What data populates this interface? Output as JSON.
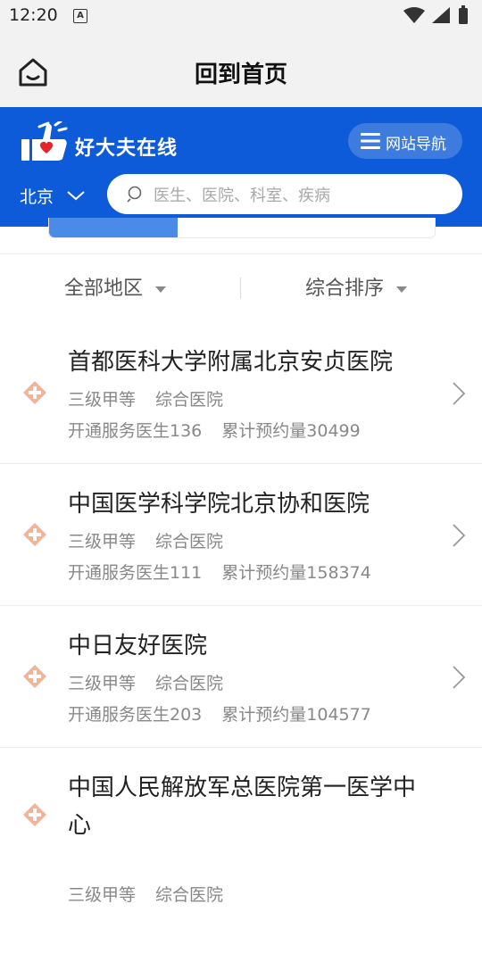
{
  "status": {
    "time": "12:20"
  },
  "titlebar": {
    "title": "回到首页"
  },
  "header": {
    "brand": "好大夫在线",
    "nav_label": "网站导航",
    "city": "北京",
    "search_placeholder": "医生、医院、科室、疾病"
  },
  "filters": {
    "region": "全部地区",
    "sort": "综合排序"
  },
  "hospitals": [
    {
      "name": "首都医科大学附属北京安贞医院",
      "grade": "三级甲等",
      "type": "综合医院",
      "doctors": "开通服务医生136",
      "bookings": "累计预约量30499"
    },
    {
      "name": "中国医学科学院北京协和医院",
      "grade": "三级甲等",
      "type": "综合医院",
      "doctors": "开通服务医生111",
      "bookings": "累计预约量158374"
    },
    {
      "name": "中日友好医院",
      "grade": "三级甲等",
      "type": "综合医院",
      "doctors": "开通服务医生203",
      "bookings": "累计预约量104577"
    },
    {
      "name": "中国人民解放军总医院第一医学中心",
      "grade": "三级甲等",
      "type": "综合医院"
    }
  ],
  "colors": {
    "brand_blue": "#0d5bd8",
    "icon_orange": "#f0b49a"
  }
}
